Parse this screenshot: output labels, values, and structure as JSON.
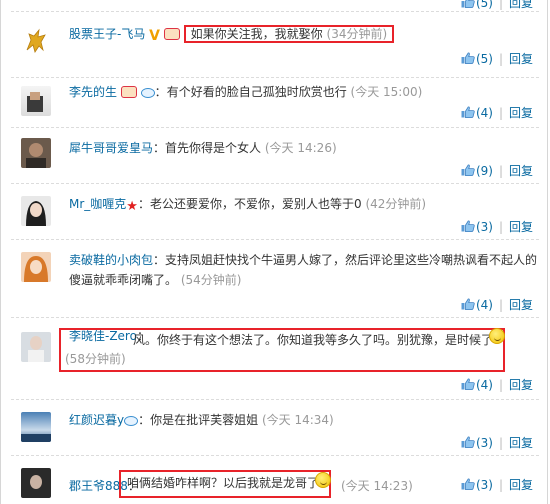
{
  "action_reply": "回复",
  "comments": [
    {
      "name": "",
      "text": "",
      "time": "",
      "likes": "(5)"
    },
    {
      "name": "股票王子-飞马",
      "text": "如果你关注我，我就娶你",
      "time": "(34分钟前)",
      "likes": "(5)"
    },
    {
      "name": "李先的生",
      "text": "有个好看的脸自己孤独时欣赏也行",
      "time": "(今天 15:00)",
      "likes": "(4)"
    },
    {
      "name": "犀牛哥哥爱皇马",
      "text": "首先你得是个女人",
      "time": "(今天 14:26)",
      "likes": "(9)"
    },
    {
      "name": "Mr_咖喱克",
      "text": "老公还要爱你，不爱你，爱别人也等于0",
      "time": "(42分钟前)",
      "likes": "(3)"
    },
    {
      "name": "卖破鞋的小肉包",
      "text": "支持凤姐赶快找个牛逼男人嫁了，然后评论里这些冷嘲热讽看不起人的",
      "text2": "傻逼就乖乖闭嘴了。",
      "time": "(54分钟前)",
      "likes": "(4)"
    },
    {
      "name": "李晓佳-Zero",
      "text": "风。你终于有这个想法了。你知道我等多久了吗。别犹豫，是时候了",
      "time": "(58分钟前)",
      "likes": "(4)"
    },
    {
      "name": "红颜迟暮y",
      "text": "你是在批评芙蓉姐姐",
      "time": "(今天 14:34)",
      "likes": "(3)"
    },
    {
      "name": "郡王爷888",
      "text": "咱俩结婚咋样啊？以后我就是龙哥了",
      "time": "(今天 14:23)",
      "likes": "(3)"
    }
  ]
}
